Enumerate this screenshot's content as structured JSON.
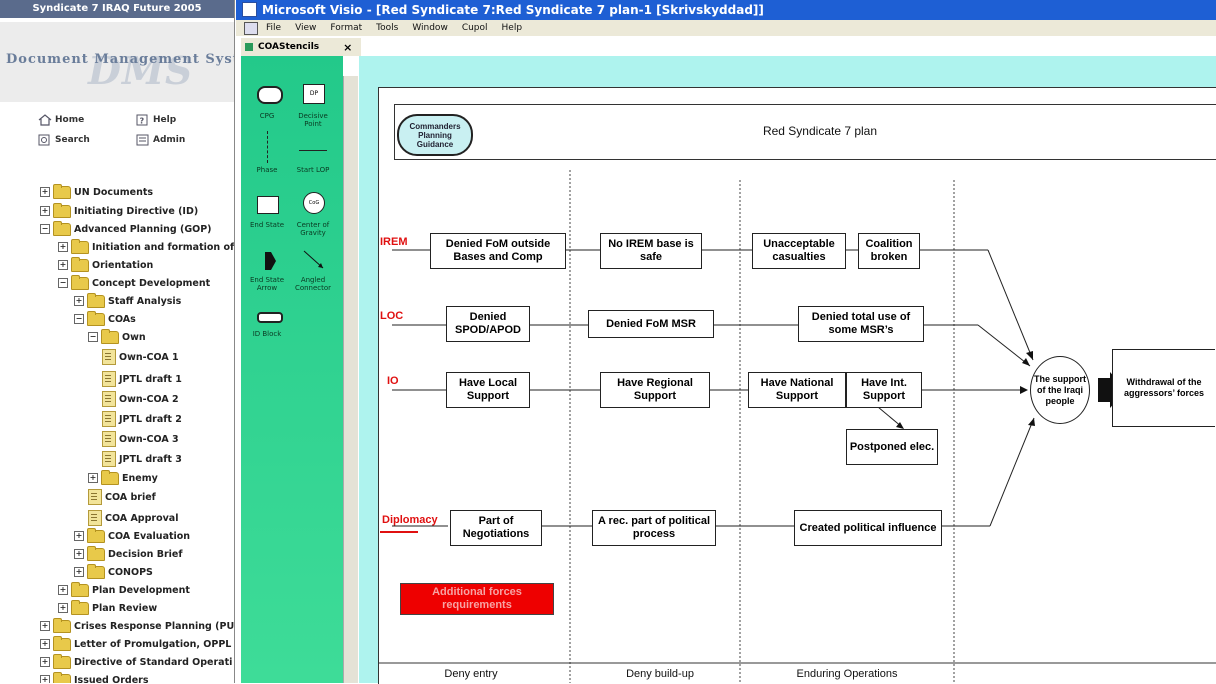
{
  "dms": {
    "title": "Syndicate 7 IRAQ Future 2005",
    "brand_big": "DMS",
    "brand_sub": "Document Management System",
    "nav": {
      "home": "Home",
      "help": "Help",
      "search": "Search",
      "admin": "Admin"
    },
    "tree": [
      "UN Documents",
      "Initiating Directive (ID)",
      "Advanced Planning (GOP)",
      "Initiation and formation of",
      "Orientation",
      "Concept Development",
      "Staff Analysis",
      "COAs",
      "Own",
      "Own-COA 1",
      "JPTL draft 1",
      "Own-COA 2",
      "JPTL draft 2",
      "Own-COA 3",
      "JPTL draft 3",
      "Enemy",
      "COA brief",
      "COA Approval",
      "COA Evaluation",
      "Decision Brief",
      "CONOPS",
      "Plan Development",
      "Plan Review",
      "Crises Response Planning (PU",
      "Letter of Promulgation, OPPL",
      "Directive of Standard Operati",
      "Issued Orders"
    ]
  },
  "visio": {
    "title": "Microsoft Visio - [Red Syndicate 7:Red Syndicate 7 plan-1  [Skrivskyddad]]",
    "menu": [
      "File",
      "View",
      "Format",
      "Tools",
      "Window",
      "Cupol",
      "Help"
    ]
  },
  "stencil": {
    "name": "COAStencils",
    "close": "×",
    "shapes": {
      "cpg": "CPG",
      "dp_icon": "DP",
      "decisive_point": "Decisive Point",
      "phase": "Phase",
      "start_lop": "Start LOP",
      "end_state": "End State",
      "cog_icon": "CoG",
      "center_gravity": "Center of Gravity",
      "end_state_arrow": "End State Arrow",
      "angled_connector": "Angled Connector",
      "id_block": "ID Block"
    }
  },
  "diagram": {
    "header_oval": "Commanders Planning Guidance",
    "header_title": "Red Syndicate 7 plan",
    "rows": {
      "irem": "IREM",
      "loc": "LOC",
      "io": "IO",
      "diplomacy": "Diplomacy"
    },
    "boxes": {
      "b_irem1": "Denied FoM outside Bases and Comp",
      "b_irem2": "No IREM base is safe",
      "b_irem3": "Unacceptable casualties",
      "b_irem4": "Coalition broken",
      "b_loc1": "Denied SPOD/APOD",
      "b_loc2": "Denied FoM MSR",
      "b_loc3": "Denied total use of some MSR’s",
      "b_io1": "Have Local Support",
      "b_io2": "Have Regional Support",
      "b_io3": "Have National Support",
      "b_io4": "Have Int. Support",
      "b_io5": "Postponed elec.",
      "b_dip1": "Part of Negotiations",
      "b_dip2": "A rec. part of political process",
      "b_dip3": "Created political influence",
      "red_box": "Additional forces requirements",
      "cog": "The support of the Iraqi people",
      "end_state": "Withdrawal of the aggressors’ forces"
    },
    "phases": [
      "Deny entry",
      "Deny build-up",
      "Enduring Operations"
    ],
    "colors": {
      "red": "#e01010",
      "canvas": "#aef3ee",
      "stencil": "#2ad08e",
      "titlebar": "#1e5fd4"
    }
  }
}
